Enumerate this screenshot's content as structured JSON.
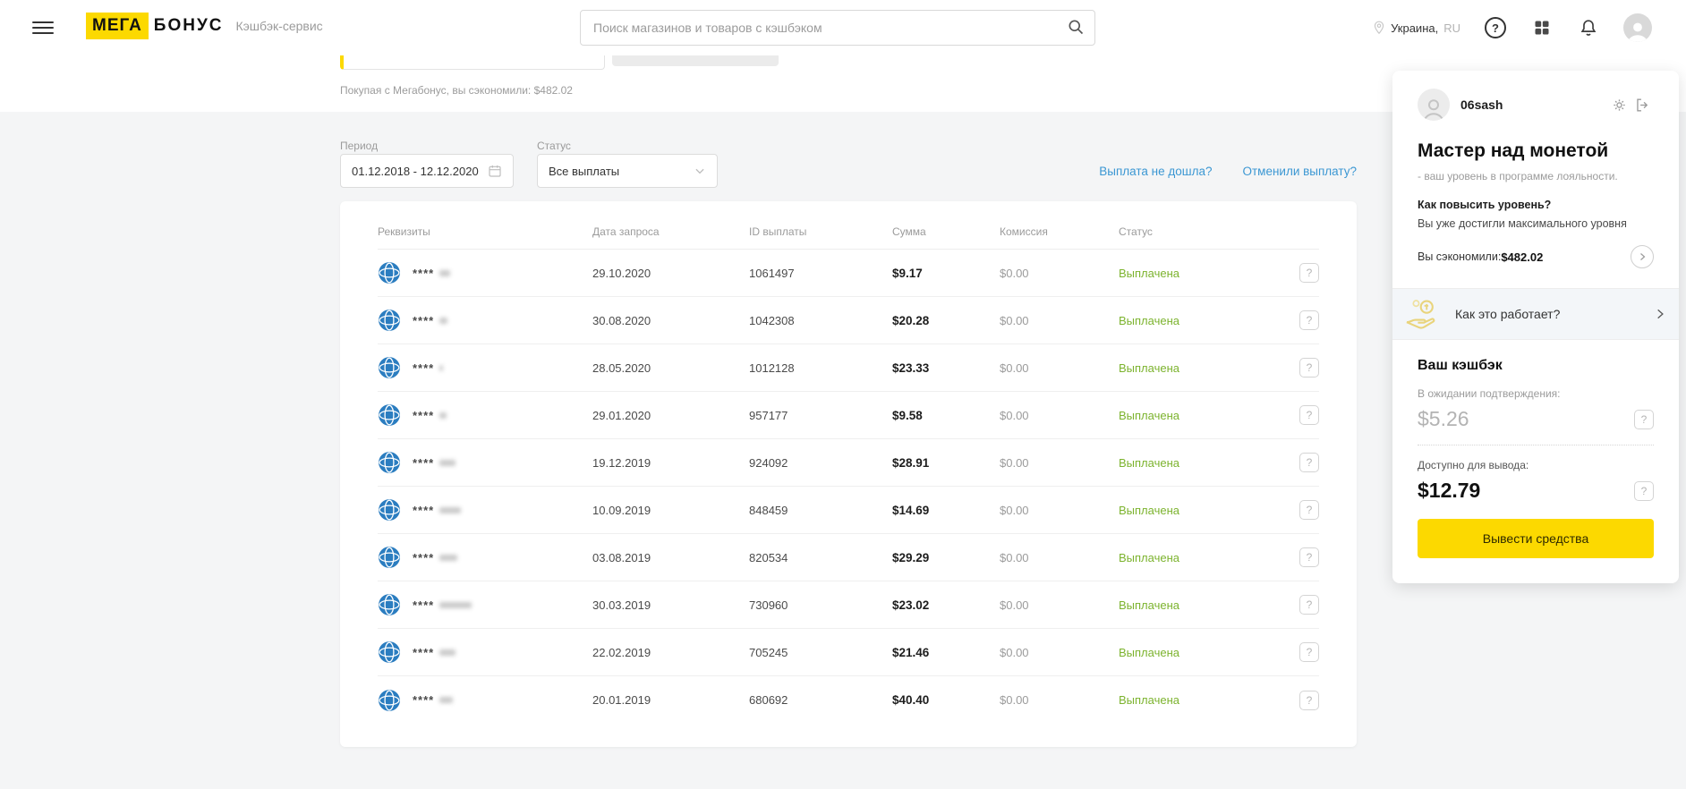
{
  "header": {
    "logo": {
      "part1": "МЕГА",
      "part2": "БОНУС",
      "tagline": "Кэшбэк-сервис"
    },
    "search": {
      "placeholder": "Поиск магазинов и товаров с кэшбэком"
    },
    "location": {
      "country": "Украина,",
      "lang": "RU"
    },
    "help_glyph": "?"
  },
  "subheader": {
    "savings_note": "Покупая с Мегабонус, вы сэкономили: $482.02"
  },
  "filters": {
    "period_label": "Период",
    "period_value": "01.12.2018 - 12.12.2020",
    "status_label": "Статус",
    "status_value": "Все выплаты",
    "link_not_received": "Выплата не дошла?",
    "link_cancelled": "Отменили выплату?"
  },
  "table": {
    "columns": [
      "Реквизиты",
      "Дата запроса",
      "ID выплаты",
      "Сумма",
      "Комиссия",
      "Статус"
    ],
    "help_glyph": "?",
    "rows": [
      {
        "requisites": "****",
        "date": "29.10.2020",
        "id": "1061497",
        "amount": "$9.17",
        "commission": "$0.00",
        "status": "Выплачена"
      },
      {
        "requisites": "****",
        "date": "30.08.2020",
        "id": "1042308",
        "amount": "$20.28",
        "commission": "$0.00",
        "status": "Выплачена"
      },
      {
        "requisites": "****",
        "date": "28.05.2020",
        "id": "1012128",
        "amount": "$23.33",
        "commission": "$0.00",
        "status": "Выплачена"
      },
      {
        "requisites": "****",
        "date": "29.01.2020",
        "id": "957177",
        "amount": "$9.58",
        "commission": "$0.00",
        "status": "Выплачена"
      },
      {
        "requisites": "****",
        "date": "19.12.2019",
        "id": "924092",
        "amount": "$28.91",
        "commission": "$0.00",
        "status": "Выплачена"
      },
      {
        "requisites": "****",
        "date": "10.09.2019",
        "id": "848459",
        "amount": "$14.69",
        "commission": "$0.00",
        "status": "Выплачена"
      },
      {
        "requisites": "****",
        "date": "03.08.2019",
        "id": "820534",
        "amount": "$29.29",
        "commission": "$0.00",
        "status": "Выплачена"
      },
      {
        "requisites": "****",
        "date": "30.03.2019",
        "id": "730960",
        "amount": "$23.02",
        "commission": "$0.00",
        "status": "Выплачена"
      },
      {
        "requisites": "****",
        "date": "22.02.2019",
        "id": "705245",
        "amount": "$21.46",
        "commission": "$0.00",
        "status": "Выплачена"
      },
      {
        "requisites": "****",
        "date": "20.01.2019",
        "id": "680692",
        "amount": "$40.40",
        "commission": "$0.00",
        "status": "Выплачена"
      }
    ]
  },
  "sidebar": {
    "username": "06sash",
    "level_title": "Мастер над монетой",
    "level_subtitle": "- ваш уровень в программе лояльности.",
    "raise_question": "Как повысить уровень?",
    "raise_answer": "Вы уже достигли максимального уровня",
    "saved_label": "Вы сэкономили:",
    "saved_value": "$482.02",
    "how_it_works": "Как это работает?",
    "cashback_title": "Ваш кэшбэк",
    "pending_label": "В ожидании подтверждения:",
    "pending_value": "$5.26",
    "available_label": "Доступно для вывода:",
    "available_value": "$12.79",
    "withdraw_button": "Вывести средства",
    "help_glyph": "?"
  },
  "colors": {
    "accent_yellow": "#fcd900",
    "status_green": "#7cb32e",
    "link_blue": "#3b97d3"
  }
}
